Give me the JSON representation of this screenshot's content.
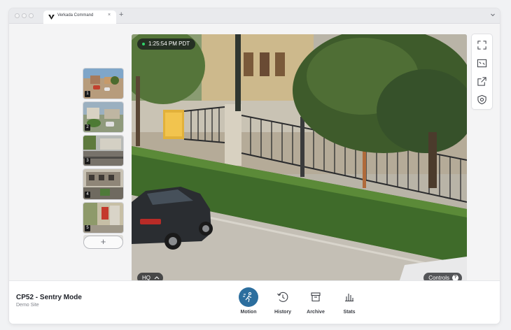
{
  "browser": {
    "tab_title": "Verkada Command",
    "tab_close": "×",
    "new_tab": "+"
  },
  "camera": {
    "timestamp": "1:25:54 PM PDT",
    "quality": "HQ",
    "controls_label": "Controls",
    "help_glyph": "?"
  },
  "thumbnails": [
    {
      "number": "1"
    },
    {
      "number": "2"
    },
    {
      "number": "3"
    },
    {
      "number": "4"
    },
    {
      "number": "5"
    }
  ],
  "add_camera_label": "+",
  "side_tools": [
    "expand-icon",
    "fit-screen-icon",
    "share-icon",
    "privacy-mask-icon"
  ],
  "footer": {
    "title": "CP52 - Sentry Mode",
    "site": "Demo Site",
    "actions": [
      {
        "label": "Motion",
        "icon": "motion-icon",
        "active": true
      },
      {
        "label": "History",
        "icon": "history-icon",
        "active": false
      },
      {
        "label": "Archive",
        "icon": "archive-icon",
        "active": false
      },
      {
        "label": "Stats",
        "icon": "stats-icon",
        "active": false
      }
    ]
  },
  "colors": {
    "accent": "#2c6e9e",
    "live": "#2fd36a"
  }
}
